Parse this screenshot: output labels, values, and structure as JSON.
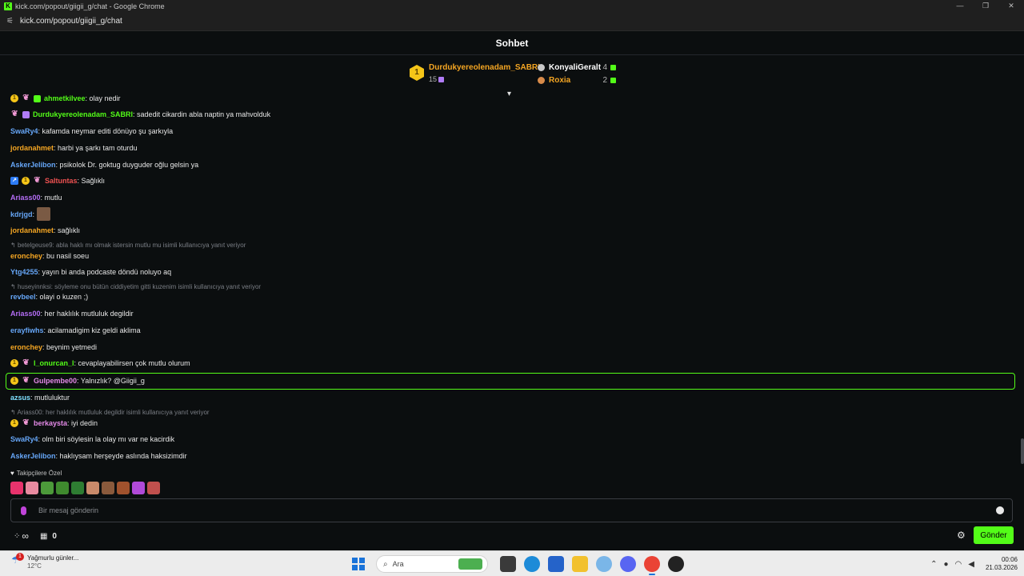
{
  "browser": {
    "title": "kick.com/popout/giigii_g/chat - Google Chrome",
    "url": "kick.com/popout/giigii_g/chat",
    "favicon": "K"
  },
  "header": {
    "title": "Sohbet"
  },
  "leaderboard": {
    "first": {
      "rank": "1",
      "name": "Durdukyereolenadam_SABRI",
      "count": "15"
    },
    "others": [
      {
        "name": "KonyaliGeralt",
        "count": "4"
      },
      {
        "name": "Roxia",
        "count": "2"
      }
    ]
  },
  "messages": [
    {
      "user": "ahmetkilvee",
      "text": ": olay nedir"
    },
    {
      "user": "Durdukyereolenadam_SABRI",
      "text": ": sadedit cikardin abla naptin ya mahvolduk"
    },
    {
      "user": "SwaRy4",
      "text": ": kafamda neymar editi dönüyo şu şarkıyla"
    },
    {
      "user": "jordanahmet",
      "text": ": harbi ya şarkı tam oturdu"
    },
    {
      "user": "AskerJelibon",
      "text": ": psikolok Dr. goktug duyguder oğlu gelsin ya"
    },
    {
      "user": "Saltuntas",
      "text": ": Sağlıklı"
    },
    {
      "user": "Ariass00",
      "text": ": mutlu"
    },
    {
      "user": "kdrjgd",
      "text": ":"
    },
    {
      "user": "jordanahmet",
      "text": ": sağlıklı"
    },
    {
      "reply": "betelgeuse9: abla haklı mı olmak istersin mutlu mu isimli kullanıcıya yanıt veriyor"
    },
    {
      "user": "eronchey",
      "text": ": bu nasil soeu"
    },
    {
      "user": "Ytg4255",
      "text": ": yayın bi anda podcaste döndü noluyo aq"
    },
    {
      "reply": "huseyinnksi: söyleme onu bütün ciddiyetim gitti kuzenim isimli kullanıcıya yanıt veriyor"
    },
    {
      "user": "revbeel",
      "text": ": olayi o kuzen ;)"
    },
    {
      "user": "Ariass00",
      "text": ": her haklılık mutluluk degildir"
    },
    {
      "user": "erayfiwhs",
      "text": ": acilamadigim kiz geldi aklima"
    },
    {
      "user": "eronchey",
      "text": ": beynim yetmedi"
    },
    {
      "user": "l_onurcan_l",
      "text": ": cevaplayabilirsen çok mutlu olurum"
    },
    {
      "user": "Gulpembe00",
      "text": ": Yalnızlık? @Giigii_g"
    },
    {
      "user": "azsus",
      "text": ": mutluluktur"
    },
    {
      "reply": "Ariass00: her haklılık mutluluk degildir isimli kullanıcıya yanıt veriyor"
    },
    {
      "user": "berkaysta",
      "text": ": iyi dedin"
    },
    {
      "user": "SwaRy4",
      "text": ": olm biri söylesin la olay mı var ne kacirdik"
    },
    {
      "user": "AskerJelibon",
      "text": ": haklıysam herşeyde aslında haksizimdir"
    }
  ],
  "emotes": {
    "label": "Takipçilere Özel",
    "colors": [
      "#e8336d",
      "#e88aa0",
      "#4c9a3a",
      "#3f8a2e",
      "#2e7d32",
      "#c98a6a",
      "#8a5a3c",
      "#a0522d",
      "#b04ad8",
      "#c0504d"
    ]
  },
  "input": {
    "placeholder": "Bir mesaj gönderin"
  },
  "controls": {
    "points": "0",
    "send_label": "Gönder"
  },
  "taskbar": {
    "weather_title": "Yağmurlu günler...",
    "weather_temp": "12°C",
    "weather_badge": "1",
    "search_placeholder": "Ara",
    "time": "00:06",
    "date": "21.03.2026"
  },
  "colors": {
    "accent": "#53fc18",
    "background": "#0b0e0f"
  }
}
